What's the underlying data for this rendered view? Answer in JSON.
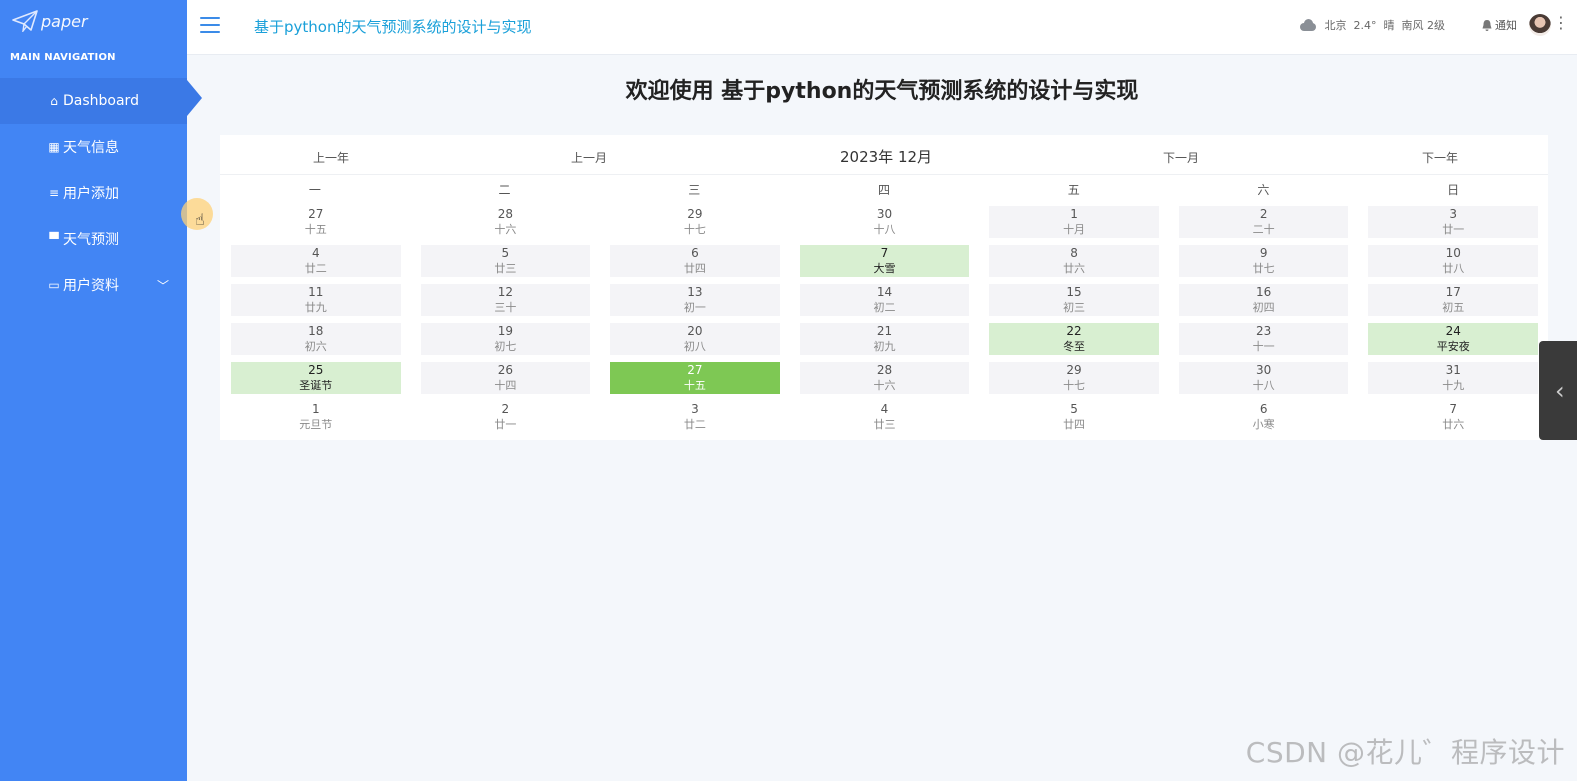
{
  "app": {
    "logo_text": "paper",
    "title": "基于python的天气预测系统的设计与实现"
  },
  "sidebar": {
    "heading": "MAIN NAVIGATION",
    "items": [
      {
        "label": "Dashboard",
        "icon": "home-icon"
      },
      {
        "label": "天气信息",
        "icon": "grid-icon"
      },
      {
        "label": "用户添加",
        "icon": "list-icon"
      },
      {
        "label": "天气预测",
        "icon": "bus-icon"
      },
      {
        "label": "用户资料",
        "icon": "card-icon"
      }
    ]
  },
  "header": {
    "weather": {
      "city": "北京",
      "temp": "2.4°",
      "condition": "晴",
      "wind": "南风 2级"
    },
    "notify_label": "通知"
  },
  "main": {
    "welcome": "欢迎使用 基于python的天气预测系统的设计与实现"
  },
  "calendar": {
    "prev_year": "上一年",
    "prev_month": "上一月",
    "title": "2023年 12月",
    "next_month": "下一月",
    "next_year": "下一年",
    "weekdays": [
      "一",
      "二",
      "三",
      "四",
      "五",
      "六",
      "日"
    ],
    "days": [
      {
        "d": "27",
        "l": "十五",
        "t": "other"
      },
      {
        "d": "28",
        "l": "十六",
        "t": "other"
      },
      {
        "d": "29",
        "l": "十七",
        "t": "other"
      },
      {
        "d": "30",
        "l": "十八",
        "t": "other"
      },
      {
        "d": "1",
        "l": "十月",
        "t": "cur"
      },
      {
        "d": "2",
        "l": "二十",
        "t": "cur"
      },
      {
        "d": "3",
        "l": "廿一",
        "t": "cur"
      },
      {
        "d": "4",
        "l": "廿二",
        "t": "cur"
      },
      {
        "d": "5",
        "l": "廿三",
        "t": "cur"
      },
      {
        "d": "6",
        "l": "廿四",
        "t": "cur"
      },
      {
        "d": "7",
        "l": "大雪",
        "t": "festival"
      },
      {
        "d": "8",
        "l": "廿六",
        "t": "cur"
      },
      {
        "d": "9",
        "l": "廿七",
        "t": "cur"
      },
      {
        "d": "10",
        "l": "廿八",
        "t": "cur"
      },
      {
        "d": "11",
        "l": "廿九",
        "t": "cur"
      },
      {
        "d": "12",
        "l": "三十",
        "t": "cur"
      },
      {
        "d": "13",
        "l": "初一",
        "t": "cur"
      },
      {
        "d": "14",
        "l": "初二",
        "t": "cur"
      },
      {
        "d": "15",
        "l": "初三",
        "t": "cur"
      },
      {
        "d": "16",
        "l": "初四",
        "t": "cur"
      },
      {
        "d": "17",
        "l": "初五",
        "t": "cur"
      },
      {
        "d": "18",
        "l": "初六",
        "t": "cur"
      },
      {
        "d": "19",
        "l": "初七",
        "t": "cur"
      },
      {
        "d": "20",
        "l": "初八",
        "t": "cur"
      },
      {
        "d": "21",
        "l": "初九",
        "t": "cur"
      },
      {
        "d": "22",
        "l": "冬至",
        "t": "festival"
      },
      {
        "d": "23",
        "l": "十一",
        "t": "cur"
      },
      {
        "d": "24",
        "l": "平安夜",
        "t": "festival"
      },
      {
        "d": "25",
        "l": "圣诞节",
        "t": "festival"
      },
      {
        "d": "26",
        "l": "十四",
        "t": "cur"
      },
      {
        "d": "27",
        "l": "十五",
        "t": "today"
      },
      {
        "d": "28",
        "l": "十六",
        "t": "cur"
      },
      {
        "d": "29",
        "l": "十七",
        "t": "cur"
      },
      {
        "d": "30",
        "l": "十八",
        "t": "cur"
      },
      {
        "d": "31",
        "l": "十九",
        "t": "cur"
      },
      {
        "d": "1",
        "l": "元旦节",
        "t": "other"
      },
      {
        "d": "2",
        "l": "廿一",
        "t": "other"
      },
      {
        "d": "3",
        "l": "廿二",
        "t": "other"
      },
      {
        "d": "4",
        "l": "廿三",
        "t": "other"
      },
      {
        "d": "5",
        "l": "廿四",
        "t": "other"
      },
      {
        "d": "6",
        "l": "小寒",
        "t": "other"
      },
      {
        "d": "7",
        "l": "廿六",
        "t": "other"
      }
    ]
  },
  "watermark": "CSDN @花儿゛程序设计",
  "colors": {
    "sidebar": "#4285f4",
    "header_title": "#1aa0d9",
    "today": "#7ec854",
    "festival": "#d8efd1"
  }
}
